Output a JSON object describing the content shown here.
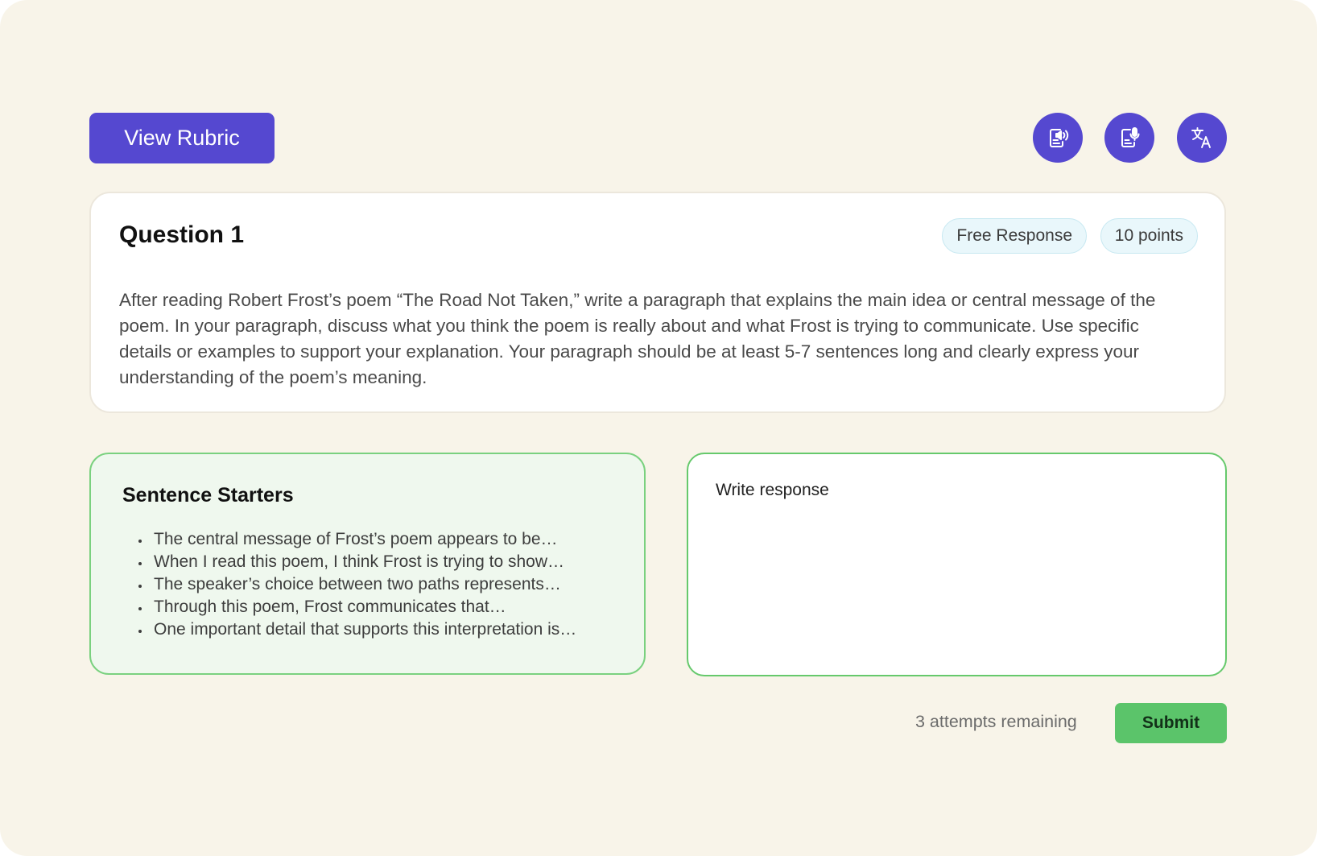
{
  "toolbar": {
    "rubric_label": "View Rubric",
    "tools": [
      {
        "name": "read-aloud",
        "icon": "document-speaker-icon"
      },
      {
        "name": "speech-to-text",
        "icon": "document-microphone-icon"
      },
      {
        "name": "translate",
        "icon": "translate-icon"
      }
    ]
  },
  "question": {
    "title": "Question 1",
    "type_badge": "Free Response",
    "points_badge": "10 points",
    "prompt": "After reading Robert Frost’s poem “The Road Not Taken,” write a paragraph that explains the main idea or central message of the poem. In your paragraph, discuss what you think the poem is really about and what Frost is trying to communicate. Use specific details or examples to support your explanation. Your paragraph should be at least 5-7 sentences long and clearly express your understanding of the poem’s meaning."
  },
  "starters": {
    "title": "Sentence Starters",
    "items": [
      "The central message of Frost’s poem appears to be…",
      "When I read this poem, I think Frost is trying to show…",
      "The speaker’s choice between two paths represents…",
      "Through this poem, Frost communicates that…",
      "One important detail that supports this interpretation is…"
    ]
  },
  "response": {
    "placeholder": "Write response",
    "value": ""
  },
  "footer": {
    "attempts": "3 attempts remaining",
    "submit_label": "Submit"
  },
  "colors": {
    "background": "#f8f4e9",
    "primary": "#5548d0",
    "success": "#5bc46a",
    "starters_bg": "#eff8ee",
    "badge_bg": "#e9f7fb"
  }
}
